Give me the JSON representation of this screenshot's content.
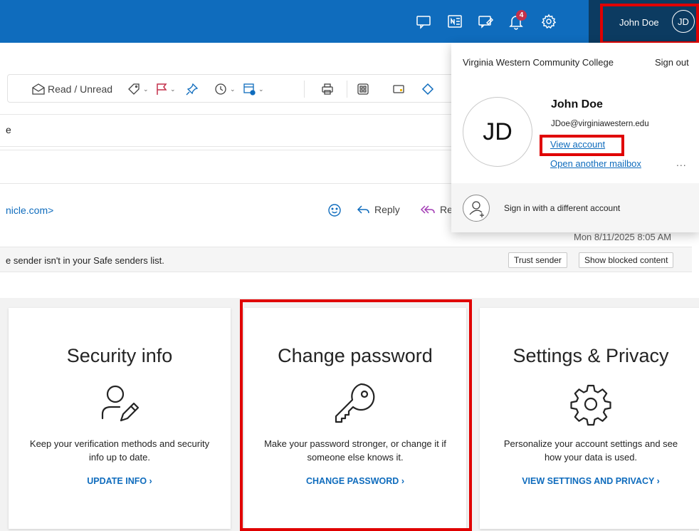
{
  "topbar": {
    "notification_count": "4",
    "user_name": "John Doe",
    "avatar_initials": "JD",
    "icons": [
      "chat-icon",
      "onenote-icon",
      "feedback-icon",
      "bell-icon",
      "gear-icon"
    ]
  },
  "toolbar": {
    "read_unread_label": "Read / Unread"
  },
  "search_fragment": "e",
  "message": {
    "sender_fragment": "nicle.com>",
    "reply_label": "Reply",
    "reply_all_fragment": "Re",
    "date": "Mon 8/11/2025 8:05 AM",
    "safe_notice": "e sender isn't in your Safe senders list.",
    "trust_sender_label": "Trust sender",
    "show_blocked_label": "Show blocked content"
  },
  "popup": {
    "org_name": "Virginia Western Community College",
    "sign_out_label": "Sign out",
    "avatar_initials": "JD",
    "name": "John Doe",
    "email": "JDoe@virginiawestern.edu",
    "view_account_label": "View account",
    "open_mailbox_label": "Open another mailbox",
    "more_label": "...",
    "other_account_label": "Sign in with a different account"
  },
  "cards": [
    {
      "title": "Security info",
      "icon": "person-edit-icon",
      "description": "Keep your verification methods and security info up to date.",
      "link": "UPDATE INFO"
    },
    {
      "title": "Change password",
      "icon": "key-icon",
      "description": "Make your password stronger, or change it if someone else knows it.",
      "link": "CHANGE PASSWORD"
    },
    {
      "title": "Settings & Privacy",
      "icon": "gear-icon",
      "description": "Personalize your account settings and see how your data is used.",
      "link": "VIEW SETTINGS AND PRIVACY"
    }
  ],
  "colors": {
    "brand_blue": "#0f6cbd",
    "account_dark": "#0c3b61",
    "highlight_red": "#e00000",
    "badge_red": "#c4314b"
  }
}
